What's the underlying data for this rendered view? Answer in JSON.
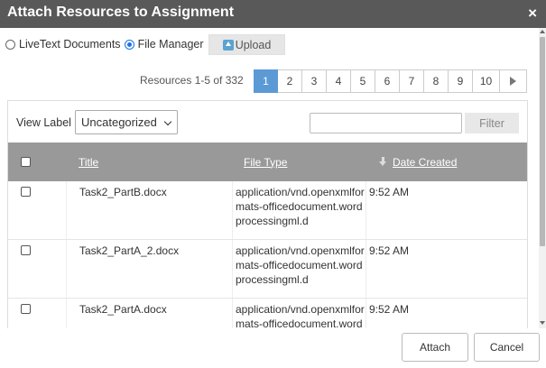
{
  "dialog": {
    "title": "Attach Resources to Assignment",
    "close_glyph": "×"
  },
  "source_options": [
    {
      "label": "LiveText Documents",
      "checked": false
    },
    {
      "label": "File Manager",
      "checked": true
    }
  ],
  "upload_label": "Upload",
  "resources_count": "Resources 1-5 of 332",
  "pagination": {
    "pages": [
      "1",
      "2",
      "3",
      "4",
      "5",
      "6",
      "7",
      "8",
      "9",
      "10"
    ],
    "active": "1"
  },
  "filter": {
    "view_label": "View Label",
    "selected_label": "Uncategorized",
    "search_value": "",
    "button_label": "Filter"
  },
  "table": {
    "columns": {
      "title": "Title",
      "file_type": "File Type",
      "date_created": "Date Created"
    },
    "rows": [
      {
        "title": "Task2_PartB.docx",
        "file_type": "application/vnd.openxmlformats-officedocument.wordprocessingml.d",
        "date": "9:52 AM"
      },
      {
        "title": "Task2_PartA_2.docx",
        "file_type": "application/vnd.openxmlformats-officedocument.wordprocessingml.d",
        "date": "9:52 AM"
      },
      {
        "title": "Task2_PartA.docx",
        "file_type": "application/vnd.openxmlformats-officedocument.wordprocessingml.d",
        "date": "9:52 AM"
      }
    ]
  },
  "footer": {
    "attach_label": "Attach",
    "cancel_label": "Cancel"
  },
  "colors": {
    "titlebar": "#595959",
    "active_page": "#5b9ad5",
    "table_header": "#999999"
  }
}
